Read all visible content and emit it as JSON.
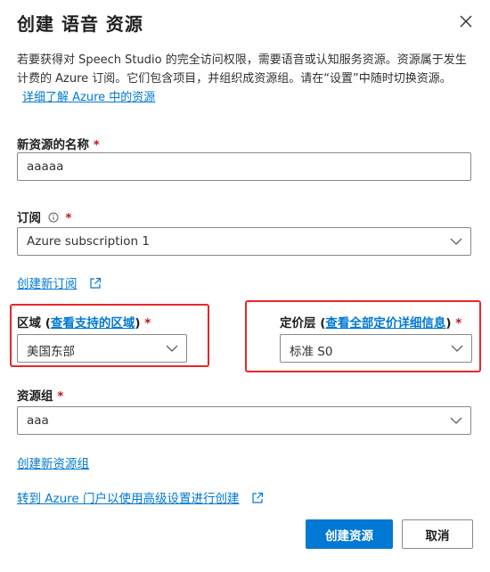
{
  "dialog": {
    "title": "创建 语音 资源",
    "description_text": "若要获得对 Speech Studio 的完全访问权限，需要语音或认知服务资源。资源属于发生计费的 Azure 订阅。它们包含项目，并组织成资源组。请在“设置”中随时切换资源。",
    "description_link": "详细了解 Azure 中的资源"
  },
  "fields": {
    "name": {
      "label": "新资源的名称",
      "required": "*",
      "value": "aaaaa"
    },
    "subscription": {
      "label": "订阅",
      "required": "*",
      "value": "Azure subscription 1",
      "create_link": "创建新订阅"
    },
    "region": {
      "label": "区域",
      "link": "查看支持的区域",
      "required": "*",
      "value": "美国东部"
    },
    "pricing": {
      "label": "定价层",
      "link": "查看全部定价详细信息",
      "required": "*",
      "value": "标准 S0"
    },
    "resource_group": {
      "label": "资源组",
      "required": "*",
      "value": "aaa",
      "create_link": "创建新资源组"
    }
  },
  "portal_link": "转到 Azure 门户以使用高级设置进行创建",
  "buttons": {
    "create": "创建资源",
    "cancel": "取消"
  },
  "colors": {
    "accent": "#0078d4",
    "highlight_box": "#e8262b",
    "required": "#c50f1f"
  }
}
